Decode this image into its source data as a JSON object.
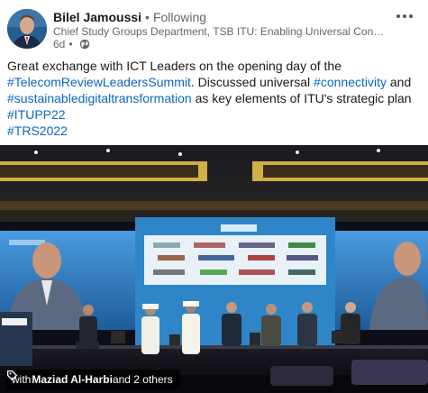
{
  "post": {
    "author": {
      "name": "Bilel Jamoussi",
      "follow_status": "Following",
      "headline": "Chief Study Groups Department, TSB ITU: Enabling Universal Connectivity an...",
      "time": "6d"
    },
    "text": {
      "l1": "Great exchange with ICT Leaders on the opening day of the",
      "tag1": "#TelecomReviewLeadersSummit",
      "l2_rest": ". Discussed universal ",
      "tag2": "#connectivity",
      "l2_end": " and",
      "tag3": "#sustainabledigitaltransformation",
      "l3_rest": " as key elements of ITU's strategic plan",
      "tag4": "#ITUPP22",
      "tag5": "#TRS2022"
    },
    "photo_tags": {
      "prefix": "with ",
      "person": "Maziad Al-Harbi",
      "suffix": " and 2 others"
    }
  },
  "colors": {
    "link": "#0a66c2",
    "secondary_text": "#666666",
    "stage_blue": "#2e86c8"
  },
  "icons": [
    "avatar",
    "more-options-icon",
    "globe-icon",
    "tag-icon"
  ]
}
